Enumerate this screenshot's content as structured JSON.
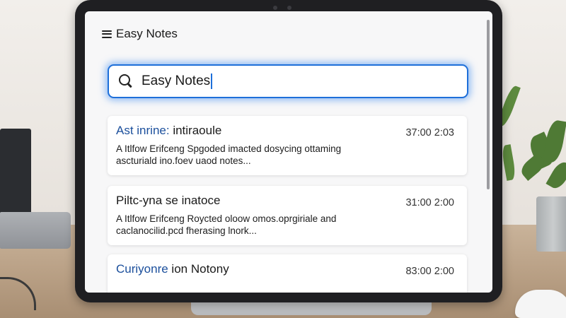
{
  "app": {
    "title": "Easy Notes"
  },
  "search": {
    "value": "Easy Notes"
  },
  "notes": [
    {
      "title_accent": "Ast inrine:",
      "title_rest": " intiraoule",
      "time": "37:00 2:03",
      "snippet": "A Itlfow Erifceng Spgoded imacted dosycing ottaming ascturiald ino.foev uaod notes..."
    },
    {
      "title_accent": "",
      "title_rest": "Piltc-yna se inatoce",
      "time": "31:00 2:00",
      "snippet": "A Itlfow Erifceng Roycted oloow omos.oprgiriale and caclanocilid.pcd fherasing lnork..."
    },
    {
      "title_accent": "Curiyonre",
      "title_rest": " ion Notony",
      "time": "83:00 2:00",
      "snippet": ""
    }
  ],
  "colors": {
    "accent": "#1e6fd9",
    "title_accent": "#1b4f9c"
  }
}
